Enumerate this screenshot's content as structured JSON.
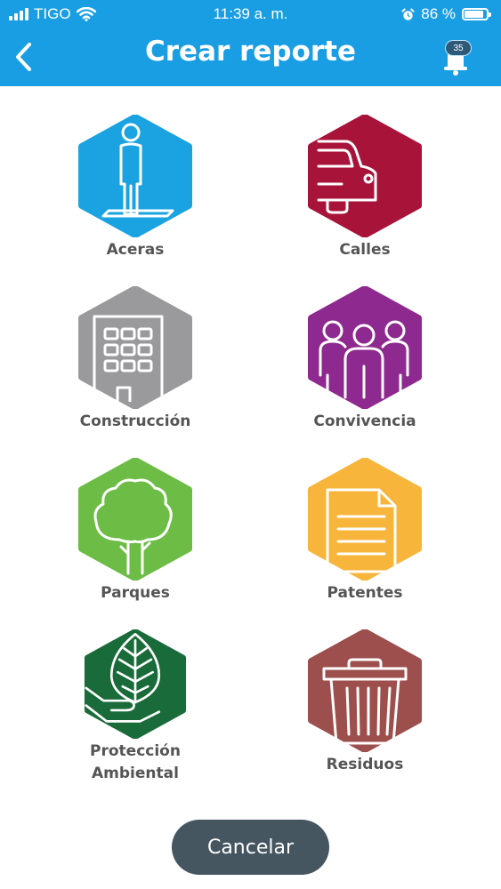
{
  "status": {
    "carrier": "TIGO",
    "time": "11:39 a. m.",
    "battery": "86 %",
    "battery_level": 0.86
  },
  "header": {
    "title": "Crear reporte",
    "notification_count": "35"
  },
  "colors": {
    "header": "#1a9ee3",
    "aceras": "#1aa3e0",
    "calles": "#a8133a",
    "construccion": "#9a9a9c",
    "convivencia": "#8e2a8f",
    "parques": "#6cbc45",
    "patentes": "#f7b53b",
    "proteccion": "#1a6b3a",
    "residuos": "#9c4f4c",
    "cancel": "#455661"
  },
  "categories": [
    {
      "id": "aceras",
      "label": "Aceras",
      "icon": "pedestrian-sidewalk-icon"
    },
    {
      "id": "calles",
      "label": "Calles",
      "icon": "car-icon"
    },
    {
      "id": "construccion",
      "label": "Construcción",
      "icon": "building-icon"
    },
    {
      "id": "convivencia",
      "label": "Convivencia",
      "icon": "people-group-icon"
    },
    {
      "id": "parques",
      "label": "Parques",
      "icon": "tree-icon"
    },
    {
      "id": "patentes",
      "label": "Patentes",
      "icon": "document-icon"
    },
    {
      "id": "proteccion",
      "label": "Protección",
      "label2": "Ambiental",
      "icon": "leaf-hand-icon"
    },
    {
      "id": "residuos",
      "label": "Residuos",
      "icon": "trash-can-icon"
    }
  ],
  "footer": {
    "cancel_label": "Cancelar"
  }
}
